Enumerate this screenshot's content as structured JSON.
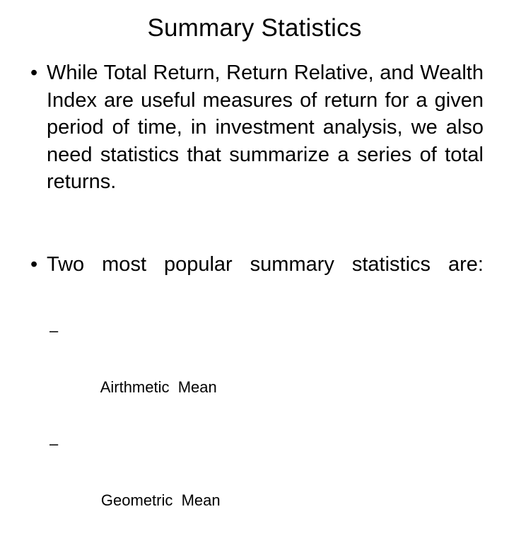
{
  "slide": {
    "title": "Summary Statistics",
    "background_color": "#ffffff",
    "text_color": "#000000",
    "bullets": [
      {
        "marker": "•",
        "text": "While Total Return, Return Relative, and Wealth Index are useful measures of return for a given period of time, in investment analysis, we also need statistics that summarize a series of total returns."
      },
      {
        "marker": "•",
        "text": "Two most popular summary statistics are:"
      }
    ],
    "sub_bullets": [
      {
        "marker": "–",
        "text": "Airthmetic  Mean"
      },
      {
        "marker": "–",
        "text": "Geometric  Mean"
      }
    ]
  }
}
